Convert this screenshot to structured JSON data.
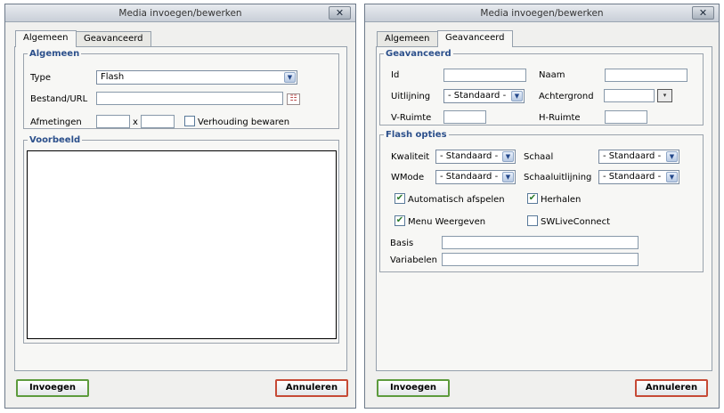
{
  "dialog1": {
    "title": "Media invoegen/bewerken",
    "close_label": "✕",
    "tabs": [
      {
        "label": "Algemeen",
        "active": true
      },
      {
        "label": "Geavanceerd",
        "active": false
      }
    ],
    "general": {
      "legend": "Algemeen",
      "type_label": "Type",
      "type_value": "Flash",
      "file_label": "Bestand/URL",
      "file_value": "",
      "dimensions_label": "Afmetingen",
      "width_value": "",
      "times_symbol": "x",
      "height_value": "",
      "constrain_label": "Verhouding bewaren",
      "constrain_checked": false
    },
    "preview": {
      "legend": "Voorbeeld"
    },
    "insert_label": "Invoegen",
    "cancel_label": "Annuleren"
  },
  "dialog2": {
    "title": "Media invoegen/bewerken",
    "close_label": "✕",
    "tabs": [
      {
        "label": "Algemeen",
        "active": false
      },
      {
        "label": "Geavanceerd",
        "active": true
      }
    ],
    "advanced": {
      "legend": "Geavanceerd",
      "id_label": "Id",
      "id_value": "",
      "name_label": "Naam",
      "name_value": "",
      "align_label": "Uitlijning",
      "align_value": "- Standaard -",
      "background_label": "Achtergrond",
      "background_value": "",
      "vspace_label": "V-Ruimte",
      "vspace_value": "",
      "hspace_label": "H-Ruimte",
      "hspace_value": ""
    },
    "flash": {
      "legend": "Flash opties",
      "quality_label": "Kwaliteit",
      "quality_value": "- Standaard -",
      "scale_label": "Schaal",
      "scale_value": "- Standaard -",
      "wmode_label": "WMode",
      "wmode_value": "- Standaard -",
      "salign_label": "Schaaluitlijning",
      "salign_value": "- Standaard -",
      "autoplay_label": "Automatisch afspelen",
      "autoplay_checked": true,
      "loop_label": "Herhalen",
      "loop_checked": true,
      "menu_label": "Menu Weergeven",
      "menu_checked": true,
      "swlive_label": "SWLiveConnect",
      "swlive_checked": false,
      "base_label": "Basis",
      "base_value": "",
      "flashvars_label": "Variabelen",
      "flashvars_value": ""
    },
    "insert_label": "Invoegen",
    "cancel_label": "Annuleren"
  },
  "icons": {
    "check_glyph": "✔",
    "dropdown_glyph": "▼",
    "browse_glyph": "☷",
    "color_picker_glyph": "▾"
  },
  "colors": {
    "legend": "#2b4f8b",
    "insert_border": "#5d9b3d",
    "cancel_border": "#c64a36"
  }
}
